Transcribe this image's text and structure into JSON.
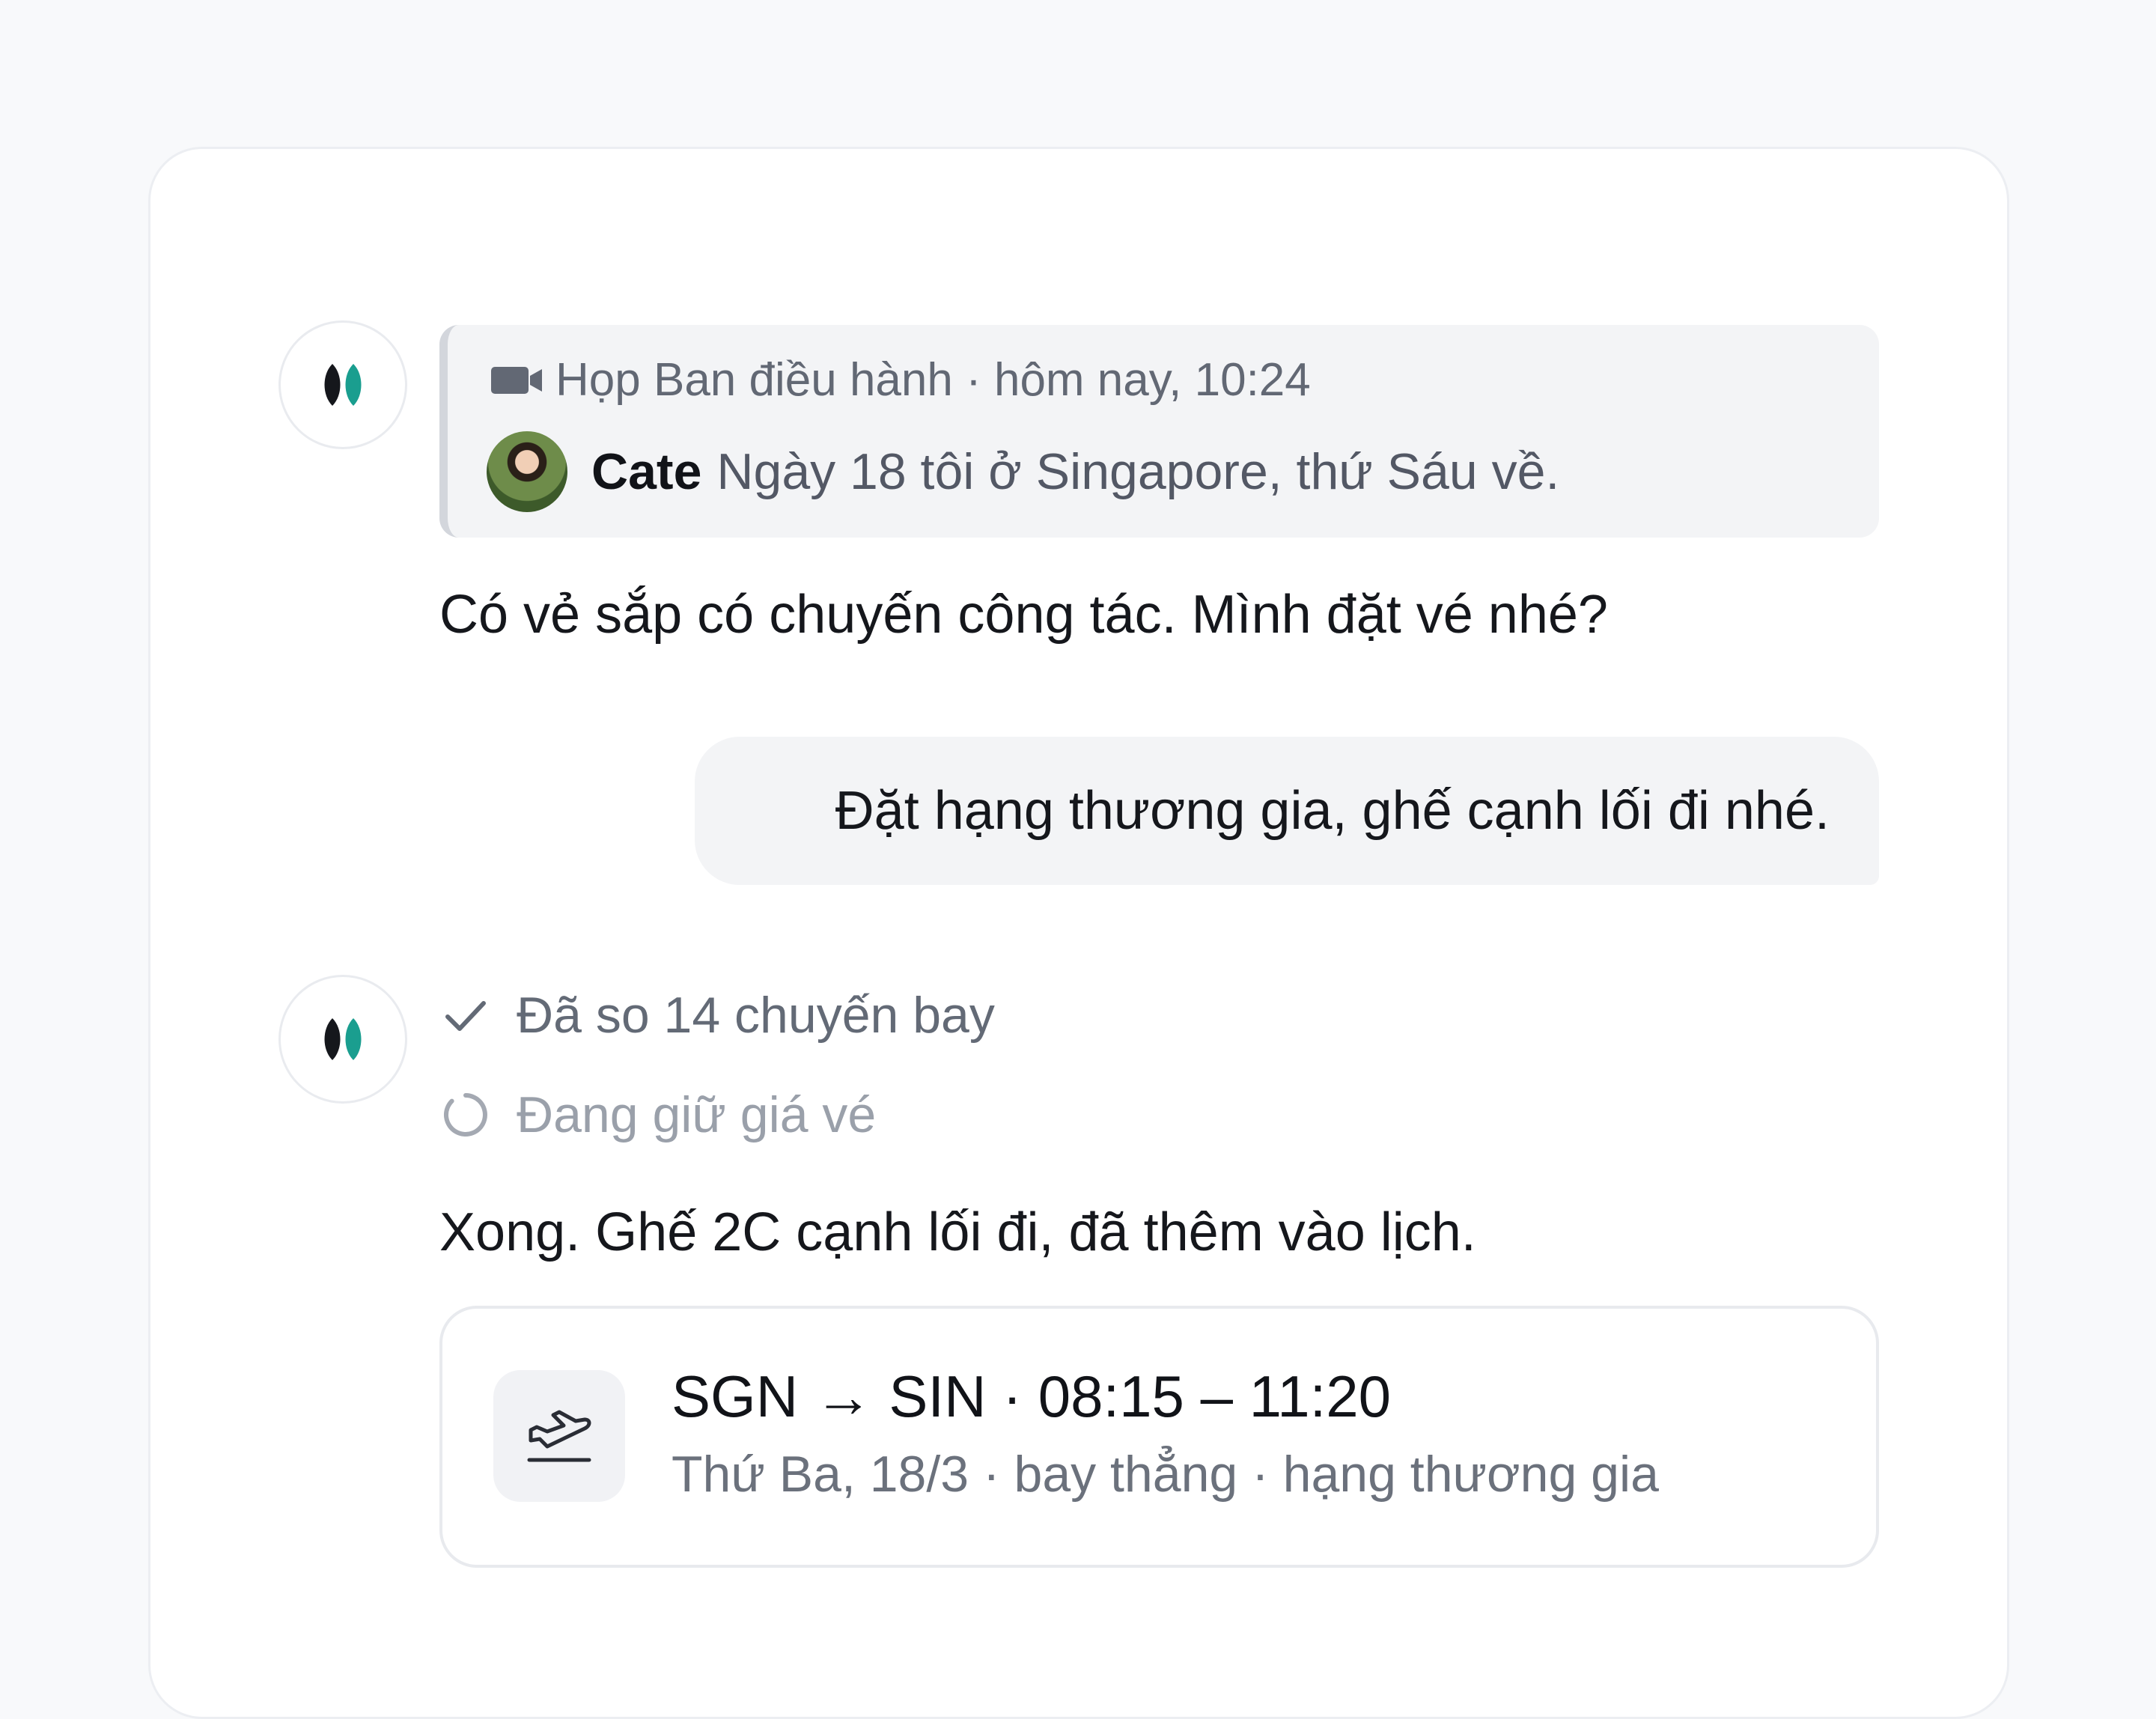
{
  "context": {
    "meeting": "Họp Ban điều hành · hôm nay, 10:24",
    "speaker": "Cate",
    "quote": "Ngày 18 tôi ở Singapore, thứ Sáu về."
  },
  "assistant_message_1": "Có vẻ sắp có chuyến công tác. Mình đặt vé nhé?",
  "user_message": "Đặt hạng thương gia, ghế cạnh lối đi nhé.",
  "steps": [
    {
      "label": "Đã so 14 chuyến bay",
      "status": "done"
    },
    {
      "label": "Đang giữ giá vé",
      "status": "pending"
    }
  ],
  "assistant_message_2": "Xong. Ghế 2C cạnh lối đi, đã thêm vào lịch.",
  "flight": {
    "route": "SGN → SIN · 08:15 – 11:20",
    "details": "Thứ Ba, 18/3 · bay thẳng · hạng thương gia"
  },
  "colors": {
    "brand_dark": "#15171c",
    "brand_accent": "#1a9e8f"
  },
  "icons": {
    "meeting": "video-camera-icon",
    "done": "check-icon",
    "pending": "spinner-icon",
    "flight": "airplane-takeoff-icon"
  }
}
